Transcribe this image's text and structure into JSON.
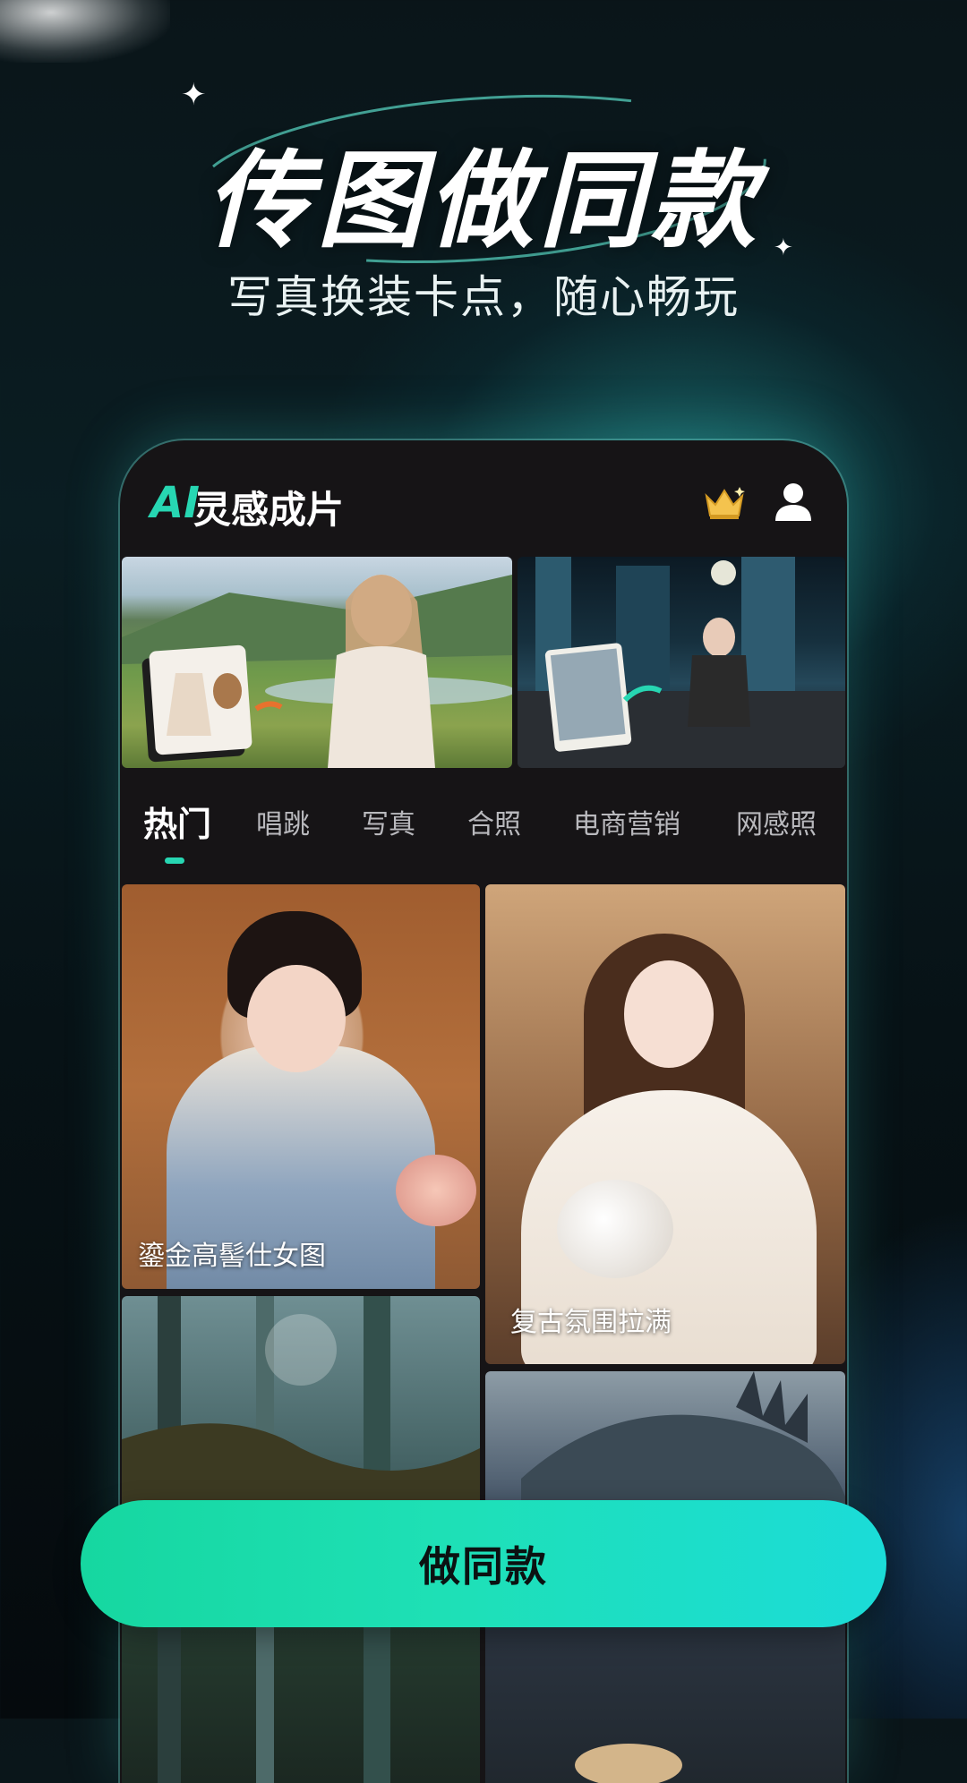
{
  "hero": {
    "title": "传图做同款",
    "subtitle": "写真换装卡点，随心畅玩"
  },
  "app": {
    "logo_ai": "AI",
    "logo_text": "灵感成片",
    "icons": [
      "crown-icon",
      "user-icon"
    ]
  },
  "tabs": [
    {
      "label": "热门",
      "active": true
    },
    {
      "label": "唱跳",
      "active": false
    },
    {
      "label": "写真",
      "active": false
    },
    {
      "label": "合照",
      "active": false
    },
    {
      "label": "电商营销",
      "active": false
    },
    {
      "label": "网感照",
      "active": false
    }
  ],
  "cards": [
    {
      "label": "鎏金高髻仕女图"
    },
    {
      "label": "复古氛围拉满"
    },
    {
      "label": ""
    },
    {
      "label": ""
    }
  ],
  "cta": {
    "label": "做同款"
  },
  "colors": {
    "accent": "#27d6b2",
    "cta_start": "#16d7a0",
    "cta_end": "#1bdcd8"
  }
}
